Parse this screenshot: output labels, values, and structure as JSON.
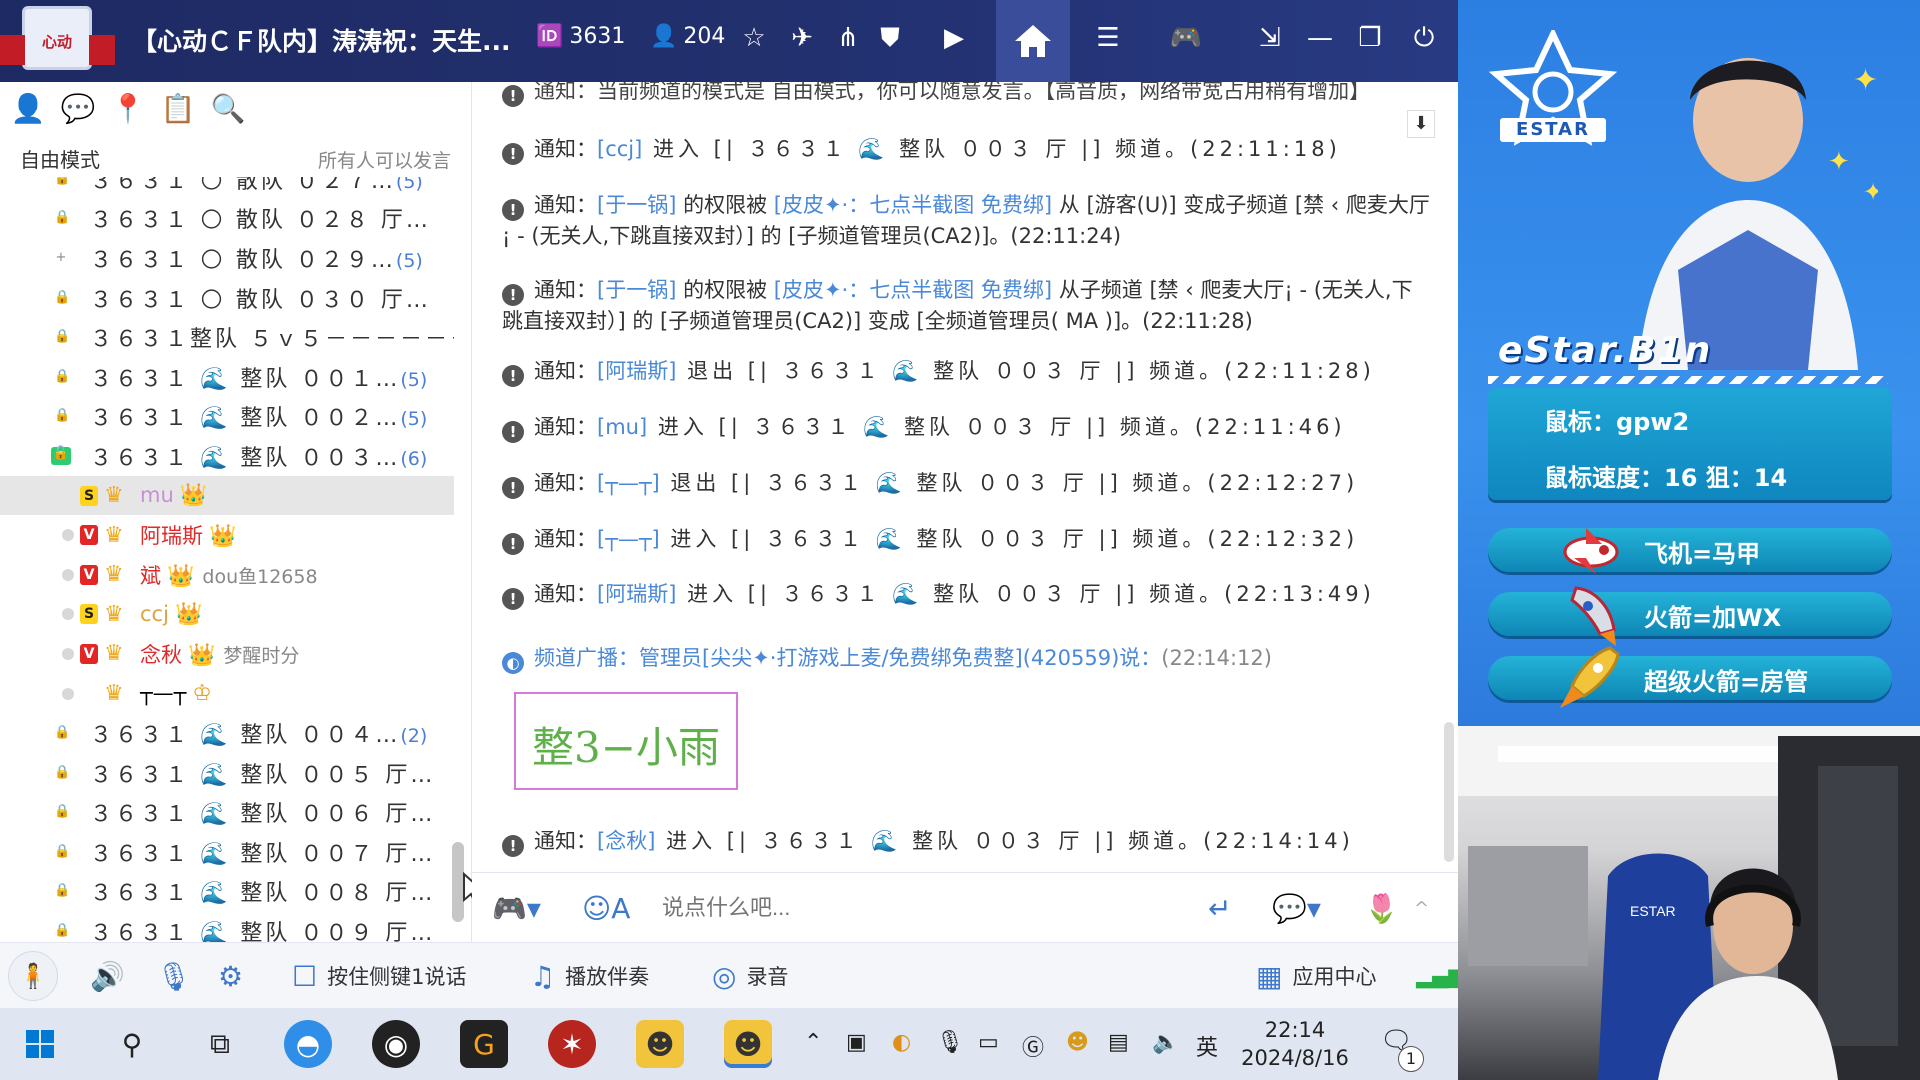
{
  "titlebar": {
    "logo_text": "心动",
    "room_title": "【心动ＣＦ队内】涛涛祝：天生...",
    "room_id": "3631",
    "online_count": "204"
  },
  "left": {
    "mode": "自由模式",
    "mode_desc": "所有人可以发言",
    "channels_top": [
      {
        "text": "３６３１ 🌕 散队 ０２７…",
        "count": "(5)",
        "lock": "🔒"
      },
      {
        "text": "３６３１ 🌕 散队 ０２８ 厅…",
        "count": "",
        "lock": "🔒"
      },
      {
        "text": "３６３１ 🌕 散队 ０２９…",
        "count": "(5)",
        "lock": "+"
      },
      {
        "text": "３６３１ 🌕 散队 ０３０ 厅…",
        "count": "",
        "lock": "🔒"
      },
      {
        "text": "３６３１整队 ５ｖ５－－－－－－",
        "count": "",
        "lock": "🔒"
      },
      {
        "text": "３６３１ 🌊 整队 ００１…",
        "count": "(5)",
        "lock": "🔒"
      },
      {
        "text": "３６３１ 🌊 整队 ００２…",
        "count": "(5)",
        "lock": "🔒"
      },
      {
        "text": "３６３１ 🌊 整队 ００３…",
        "count": "(6)",
        "lock": "🔓"
      }
    ],
    "users": [
      {
        "badge": "S",
        "name": "mu",
        "extra": "",
        "name_color": "#c88fd8",
        "active": true
      },
      {
        "badge": "V",
        "name": "阿瑞斯",
        "extra": "",
        "name_color": "#e02a2a",
        "active": false
      },
      {
        "badge": "V",
        "name": "斌",
        "extra": "dou鱼12658",
        "name_color": "#e02a2a",
        "active": false
      },
      {
        "badge": "S",
        "name": "ccj",
        "extra": "",
        "name_color": "#d8a642",
        "active": false
      },
      {
        "badge": "V",
        "name": "念秋",
        "extra": "梦醒时分",
        "name_color": "#e02a2a",
        "active": false
      },
      {
        "badge": "",
        "name": "┬—┬",
        "extra": "",
        "name_color": "#333333",
        "active": false
      }
    ],
    "channels_bottom": [
      {
        "text": "３６３１ 🌊 整队 ００４…",
        "count": "(2)",
        "lock": "🔒"
      },
      {
        "text": "３６３１ 🌊 整队 ００５ 厅…",
        "count": "",
        "lock": "🔒"
      },
      {
        "text": "３６３１ 🌊 整队 ００６ 厅…",
        "count": "",
        "lock": "🔒"
      },
      {
        "text": "３６３１ 🌊 整队 ００７ 厅…",
        "count": "",
        "lock": "🔒"
      },
      {
        "text": "３６３１ 🌊 整队 ００８ 厅…",
        "count": "",
        "lock": "🔒"
      },
      {
        "text": "３６３１ 🌊 整队 ００９ 厅…",
        "count": "",
        "lock": "🔒"
      }
    ]
  },
  "chat": {
    "m0": "通知：当前频道的模式是 自由模式，你可以随意发言。【高音质，网络带宽占用稍有增加】",
    "m1_pre": "通知：",
    "m1_user": "[ccj]",
    "m1_post": " 进入 [| ３６３１ 🌊 整队 ００３ 厅 |] 频道。(22:11:18)",
    "m2_pre": "通知：",
    "m2_user": "[于一锅]",
    "m2_mid": " 的权限被 ",
    "m2_admin": "[皮皮✦·：七点半截图 免费绑]",
    "m2_post": " 从 [游客(U)] 变成子频道 [禁 ‹ 爬麦大厅¡ - (无关人,下跳直接双封）] 的 [子频道管理员(CA2)]。(22:11:24)",
    "m3_pre": "通知：",
    "m3_user": "[于一锅]",
    "m3_mid": " 的权限被 ",
    "m3_admin": "[皮皮✦·：七点半截图 免费绑]",
    "m3_post": " 从子频道 [禁 ‹ 爬麦大厅¡ - (无关人,下跳直接双封）] 的 [子频道管理员(CA2)] 变成 [全频道管理员( MA )]。(22:11:28)",
    "m4_pre": "通知：",
    "m4_user": "[阿瑞斯]",
    "m4_post": " 退出 [| ３６３１ 🌊 整队 ００３ 厅 |] 频道。(22:11:28)",
    "m5_pre": "通知：",
    "m5_user": "[mu]",
    "m5_post": " 进入 [| ３６３１ 🌊 整队 ００３ 厅 |] 频道。(22:11:46)",
    "m6_pre": "通知：",
    "m6_user": "[┬—┬]",
    "m6_post": " 退出 [| ３６３１ 🌊 整队 ００３ 厅 |] 频道。(22:12:27)",
    "m7_pre": "通知：",
    "m7_user": "[┬—┬]",
    "m7_post": " 进入 [| ３６３１ 🌊 整队 ００３ 厅 |] 频道。(22:12:32)",
    "m8_pre": "通知：",
    "m8_user": "[阿瑞斯]",
    "m8_post": " 进入 [| ３６３１ 🌊 整队 ００３ 厅 |] 频道。(22:13:49)",
    "broadcast": "频道广播：管理员[尖尖✦·打游戏上麦/免费绑免费整](420559)说：",
    "broadcast_time": "(22:14:12)",
    "banner_text": "整3−小雨",
    "m9_pre": "通知：",
    "m9_user": "[念秋]",
    "m9_post": " 进入 [| ３６３１ 🌊 整队 ００３ 厅 |] 频道。(22:14:14)"
  },
  "input": {
    "placeholder": "说点什么吧..."
  },
  "bottom": {
    "ptt": "按住侧键1说话",
    "music": "播放伴奏",
    "record": "录音",
    "apps": "应用中心"
  },
  "taskbar": {
    "time": "22:14",
    "date": "2024/8/16",
    "ime": "英",
    "notif_count": "1"
  },
  "overlay": {
    "team_logo": "ESTAR",
    "player": "eStar.B1n",
    "mouse": "鼠标：gpw2",
    "mouse_speed": "鼠标速度：16 狙：14",
    "gift1": "飞机=马甲",
    "gift2": "火箭=加WX",
    "gift3": "超级火箭=房管"
  }
}
